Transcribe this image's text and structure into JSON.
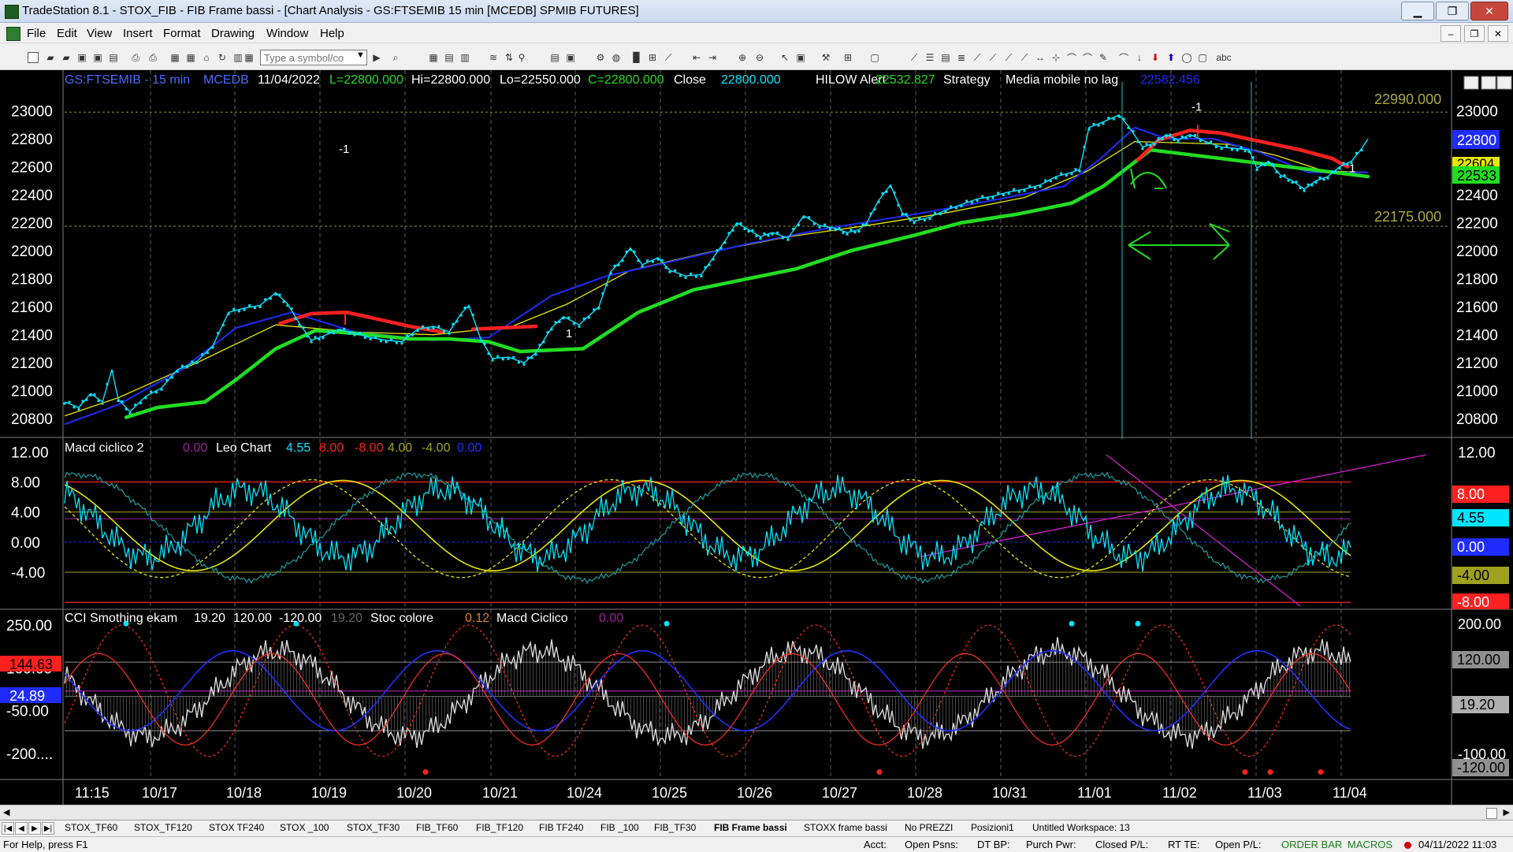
{
  "window": {
    "title": "TradeStation 8.1 - STOX_FIB - FIB Frame bassi - [Chart Analysis - GS:FTSEMIB  15 min  [MCEDB] SPMIB FUTURES]",
    "minimize": "▁",
    "maximize": "❐",
    "close": "✕"
  },
  "menu": [
    "File",
    "Edit",
    "View",
    "Insert",
    "Format",
    "Drawing",
    "Window",
    "Help"
  ],
  "mdi": {
    "minimize": "–",
    "restore": "❐",
    "close": "✕"
  },
  "toolbar": {
    "symbol_placeholder": "Type a symbol/co",
    "text_tool": "abc"
  },
  "price_panel": {
    "header": {
      "symbol": "GS:FTSEMIB - 15 min",
      "source": "MCEDB",
      "date": "11/04/2022",
      "low": "L=22800.000",
      "high": "Hi=22800.000",
      "lo": "Lo=22550.000",
      "close": "C=22800.000",
      "close_label": "Close",
      "close_val": "22800.000",
      "hilow": "HILOW Alert",
      "hilow_val": "22532.827",
      "strategy": "Strategy",
      "media": "Media mobile no lag",
      "media_val": "22582.456"
    },
    "y_ticks": [
      "23000",
      "22800",
      "22600",
      "22400",
      "22200",
      "22000",
      "21800",
      "21600",
      "21400",
      "21200",
      "21000",
      "20800"
    ],
    "ylim": [
      20700,
      23200
    ],
    "level_high": "22990.000",
    "level_low": "22175.000",
    "tag_last": "22800",
    "tag_media": "22604",
    "tag_hilow": "22533",
    "markers": [
      "-1",
      "-1",
      "1",
      "1"
    ],
    "colors": {
      "price": "#00e5ff",
      "ma_blue": "#1f2bff",
      "ma_yellow": "#e6e600",
      "hilow_green": "#22dd22",
      "hilow_red": "#ff2020"
    }
  },
  "macd_panel": {
    "header": {
      "name": "Macd ciclico 2",
      "v1": "0.00",
      "leo": "Leo Chart",
      "v2": "4.55",
      "v3": "8.00",
      "v4": "-8.00",
      "v5": "4.00",
      "v6": "-4.00",
      "v7": "0.00"
    },
    "y_ticks": [
      "12.00",
      "8.00",
      "4.00",
      "0.00",
      "-4.00"
    ],
    "ylim": [
      -8.5,
      13.5
    ],
    "tags": [
      "8.00",
      "4.55",
      "0.00",
      "-4.00",
      "-8.00"
    ]
  },
  "cci_panel": {
    "header": {
      "name": "CCI Smothing ekam",
      "v1": "19.20",
      "v2": "120.00",
      "v3": "-120.00",
      "v4": "19.20",
      "stoc": "Stoc colore",
      "v5": "0.12",
      "macd": "Macd Ciclico",
      "v6": "0.00"
    },
    "y_ticks": [
      "250.00",
      "100.00",
      "-50.00",
      "-200...."
    ],
    "ylim": [
      -280,
      300
    ],
    "tags_left": [
      "144.63",
      "24.89"
    ],
    "tags_right": [
      "200.00",
      "120.00",
      "19.20",
      "-100.00",
      "-120.00"
    ]
  },
  "x_labels": [
    "11:15",
    "10/17",
    "10/18",
    "10/19",
    "10/20",
    "10/21",
    "10/24",
    "10/25",
    "10/26",
    "10/27",
    "10/28",
    "10/31",
    "11/01",
    "11/02",
    "11/03",
    "11/04"
  ],
  "tabs": [
    "STOX_TF60",
    "STOX_TF120",
    "STOX TF240",
    "STOX _100",
    "STOX_TF30",
    "FIB_TF60",
    "FIB_TF120",
    "FIB TF240",
    "FIB _100",
    "FIB_TF30",
    "FIB Frame bassi",
    "STOXX frame bassi",
    "No PREZZI",
    "Posizioni1",
    "Untitled Workspace:  13"
  ],
  "status": {
    "help": "For Help, press F1",
    "acct": "Acct:",
    "open_psns": "Open Psns:",
    "dt_bp": "DT BP:",
    "purch_pwr": "Purch Pwr:",
    "closed_pl": "Closed P/L:",
    "rt_te": "RT TE:",
    "open_pl": "Open P/L:",
    "order_bar": "ORDER BAR",
    "macros": "MACROS",
    "datetime": "04/11/2022 11:03"
  }
}
